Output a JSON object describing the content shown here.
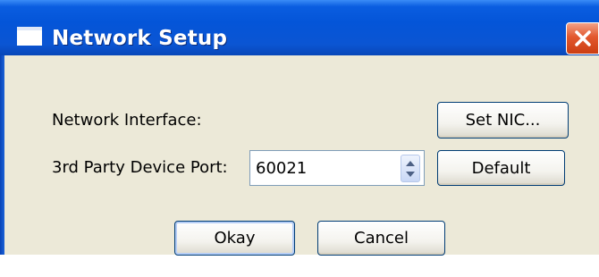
{
  "window": {
    "title": "Network Setup",
    "title_icon": "window-icon",
    "close_icon": "close-icon"
  },
  "network_interface": {
    "label": "Network Interface:",
    "button_label": "Set NIC..."
  },
  "device_port": {
    "label": "3rd Party Device Port:",
    "value": "60021",
    "spinner_icon": "up-down-arrows-icon",
    "button_label": "Default"
  },
  "actions": {
    "okay_label": "Okay",
    "cancel_label": "Cancel"
  },
  "colors": {
    "titlebar": "#0455d8",
    "dialog_bg": "#ece9d8",
    "close_button": "#e2582e",
    "button_border": "#003c74"
  }
}
